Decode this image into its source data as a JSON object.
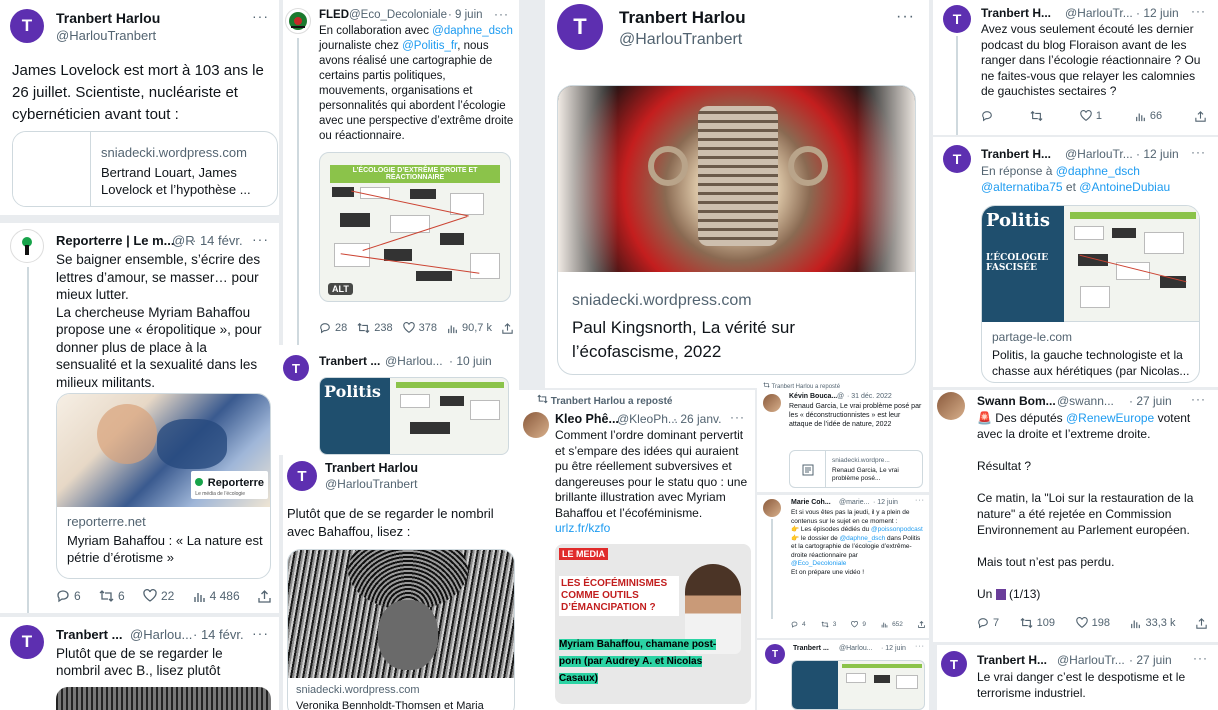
{
  "colors": {
    "accent": "#1d9bf0",
    "avatar": "#5d2fb0",
    "highlight": "#2cd3a4"
  },
  "c1": {
    "avatar": "T",
    "name": "Tranbert Harlou",
    "handle": "@HarlouTranbert",
    "more": "···",
    "text": "James Lovelock est mort à 103 ans le 26 juillet. Scientiste, nucléariste et cybernéticien avant tout :",
    "card_domain": "sniadecki.wordpress.com",
    "card_title": "Bertrand Louart, James Lovelock et l’hypothèse ..."
  },
  "c2": {
    "name": "Reporterre | Le m...",
    "handle": "@R",
    "date": "· 14 févr.",
    "more": "···",
    "text": "Se baigner ensemble, s’écrire des lettres d’amour, se masser… pour mieux lutter.\nLa chercheuse Myriam Bahaffou propose une « éropolitique », pour donner plus de place à la sensualité et la sexualité dans les milieux militants.",
    "brand": "Reporterre",
    "brand_sub": "Le média de l’écologie",
    "card_domain": "reporterre.net",
    "card_title": "Myriam Bahaffou : « La nature est pétrie d’érotisme »",
    "replies": "6",
    "retweets": "6",
    "likes": "22",
    "views": "4 486"
  },
  "c3": {
    "avatar": "T",
    "name": "Tranbert ...",
    "handle": "@Harlou...",
    "date": "· 14 févr.",
    "more": "···",
    "text": "Plutôt que de se regarder le nombril avec B., lisez plutôt"
  },
  "c4": {
    "name": "FLED",
    "handle": "@Eco_Decoloniale",
    "date": "· 9 juin",
    "more": "···",
    "text_a": "En collaboration avec ",
    "mention": "@daphne_dsch",
    "text_b": " journaliste chez ",
    "mention2": "@Politis_fr",
    "text_c": ", nous avons réalisé une cartographie de certains partis politiques, mouvements, organisations et personnalités qui abordent l’écologie avec une perspective d’extrême droite ou réactionnaire.",
    "infographic_title": "L’ÉCOLOGIE D’EXTRÊME DROITE ET RÉACTIONNAIRE",
    "alt": "ALT",
    "replies": "28",
    "retweets": "238",
    "likes": "378",
    "views": "90,7 k"
  },
  "c5": {
    "avatar": "T",
    "name": "Tranbert ...",
    "handle": "@Harlou...",
    "date": "· 10 juin",
    "magazine": "Politis"
  },
  "c6": {
    "avatar": "T",
    "name": "Tranbert Harlou",
    "handle": "@HarlouTranbert",
    "text": "Plutôt que de se regarder le nombril avec Bahaffou, lisez :",
    "card_domain": "sniadecki.wordpress.com",
    "card_title": "Veronika Bennholdt-Thomsen et Maria"
  },
  "c7": {
    "avatar": "T",
    "name": "Tranbert Harlou",
    "handle": "@HarlouTranbert",
    "more": "···",
    "card_domain": "sniadecki.wordpress.com",
    "card_title": "Paul Kingsnorth, La vérité sur l’écofascisme, 2022"
  },
  "c8": {
    "repost": "Tranbert Harlou a reposté",
    "name": "Kleo Phê...",
    "handle": "@KleoPh...",
    "date": "· 26 janv.",
    "more": "···",
    "text": "Comment l’ordre dominant pervertit et s’empare des idées qui auraient pu être réellement subversives et dangereuses pour le statu quo : une brillante illustration avec Myriam Bahaffou et l’écoféminisme.",
    "link": "urlz.fr/kzfo",
    "logo": "LE MEDIA",
    "headline": "LES ÉCOFÉMINISMES COMME OUTILS D’ÉMANCIPATION ?",
    "caption": "Myriam Bahaffou, chamane post-porn (par Audrey A. et Nicolas Casaux)"
  },
  "c9": {
    "repost": "Tranbert Harlou a reposté",
    "name": "Kévin Bouca...",
    "handle": "@",
    "date": "· 31 déc. 2022",
    "text": "Renaud Garcia, Le vrai problème posé par les « déconstructionnistes » est leur attaque de l’idée de nature, 2022",
    "card_domain": "sniadecki.wordpre...",
    "card_title": "Renaud Garcia, Le vrai problème posé..."
  },
  "c10": {
    "name": "Marie Coh...",
    "handle": "@marie...",
    "date": "· 12 juin",
    "more": "···",
    "l1": "Et si vous êtes pas la jeudi, il y a plein de contenus sur le sujet en ce moment :",
    "l2": "Les épisodes dédiés du ",
    "m1": "@poissonpodcast",
    "l3": " le dossier de ",
    "m2": "@daphne_dsch",
    "l3b": " dans Politis et la cartographie de l’écologie d’extrême-droite réactionnaire par",
    "m3": "@Eco_Decoloniale",
    "l4": "Et on prépare une vidéo !",
    "replies": "4",
    "retweets": "3",
    "likes": "9",
    "views": "652"
  },
  "c11": {
    "avatar": "T",
    "name": "Tranbert ...",
    "handle": "@Harlou...",
    "date": "· 12 juin",
    "more": "···"
  },
  "c12": {
    "avatar": "T",
    "name": "Tranbert H...",
    "handle": "@HarlouTr...",
    "date": "· 12 juin",
    "more": "···",
    "text": "Avez vous seulement écouté les dernier podcast du blog Floraison avant de les ranger dans l’écologie réactionnaire ? Ou ne faites-vous que relayer les calomnies de gauchistes sectaires ?",
    "replies": "",
    "retweets": "",
    "likes": "1",
    "views": "66"
  },
  "c13": {
    "avatar": "T",
    "name": "Tranbert H...",
    "handle": "@HarlouTr...",
    "date": "· 12 juin",
    "more": "···",
    "reply_prefix": "En réponse à ",
    "m1": "@daphne_dsch",
    "m2": "@alternatiba75",
    "and": "et",
    "m3": "@AntoineDubiau",
    "magazine": "Politis",
    "cover_text": "L’ÉCOLOGIE FASCISÉE",
    "card_domain": "partage-le.com",
    "card_title": "Politis, la gauche technologiste et la chasse aux hérétiques (par Nicolas..."
  },
  "c14": {
    "name": "Swann Bom...",
    "handle": "@swann...",
    "date": "· 27 juin",
    "more": "···",
    "t1a": " Des députés ",
    "m1": "@RenewEurope",
    "t1b": " votent avec la droite et l’extreme droite.",
    "t2": "Résultat ?",
    "t3": "Ce matin, la \"Loi sur la restauration de la nature\" a été rejetée en Commission Environnement au Parlement européen.",
    "t4": "Mais tout n’est pas perdu.",
    "t5": "Un ",
    "t5b": " (1/13)",
    "replies": "7",
    "retweets": "109",
    "likes": "198",
    "views": "33,3 k"
  },
  "c15": {
    "avatar": "T",
    "name": "Tranbert H...",
    "handle": "@HarlouTr...",
    "date": "· 27 juin",
    "more": "···",
    "text": "Le vrai danger c’est le despotisme et le terrorisme industriel."
  }
}
